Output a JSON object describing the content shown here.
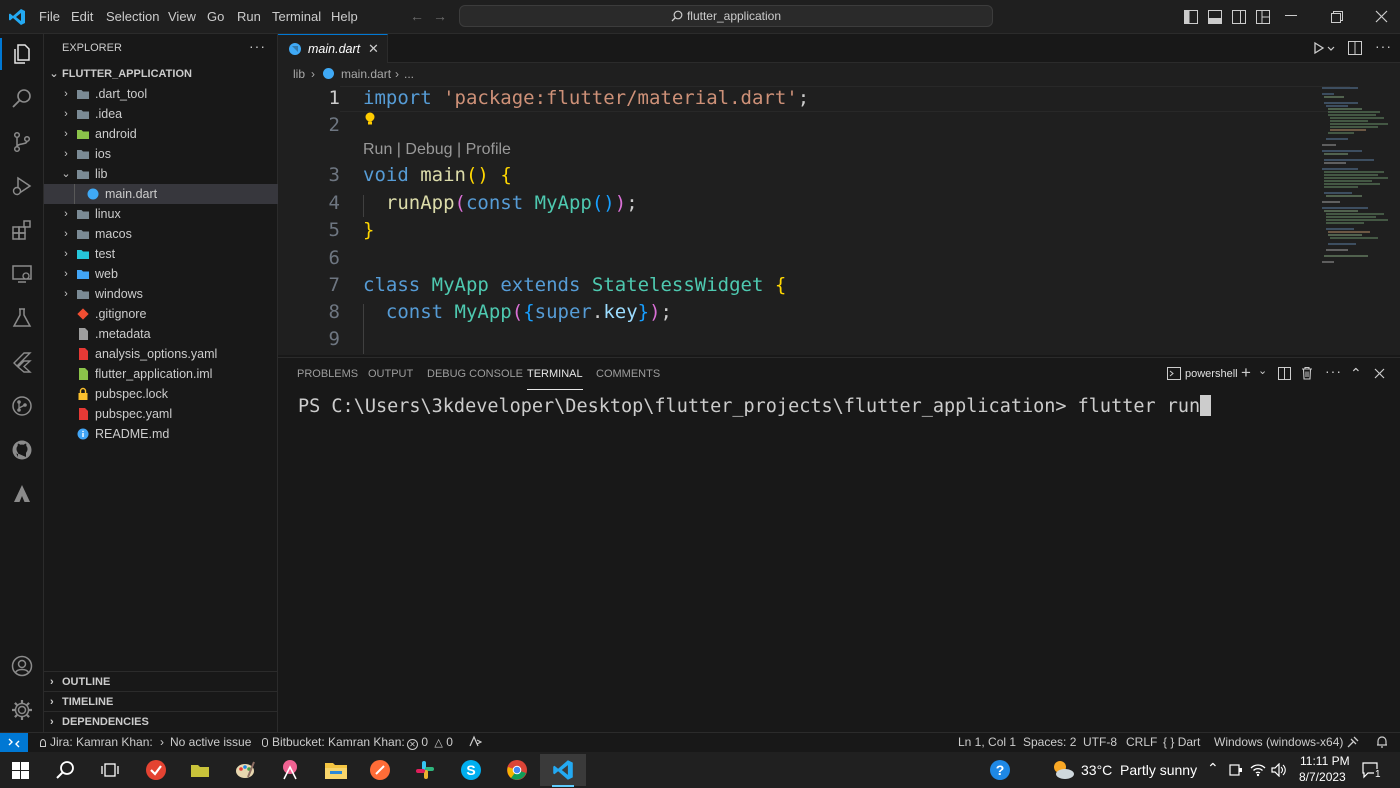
{
  "menu": [
    "File",
    "Edit",
    "Selection",
    "View",
    "Go",
    "Run",
    "Terminal",
    "Help"
  ],
  "command_center": "flutter_application",
  "explorer": {
    "header": "EXPLORER",
    "root": "FLUTTER_APPLICATION",
    "items": [
      {
        "label": ".dart_tool",
        "kind": "folder"
      },
      {
        "label": ".idea",
        "kind": "folder"
      },
      {
        "label": "android",
        "kind": "folder"
      },
      {
        "label": "ios",
        "kind": "folder"
      },
      {
        "label": "lib",
        "kind": "folder-open"
      },
      {
        "label": "main.dart",
        "kind": "dart-file"
      },
      {
        "label": "linux",
        "kind": "folder"
      },
      {
        "label": "macos",
        "kind": "folder"
      },
      {
        "label": "test",
        "kind": "folder"
      },
      {
        "label": "web",
        "kind": "folder"
      },
      {
        "label": "windows",
        "kind": "folder"
      },
      {
        "label": ".gitignore",
        "kind": "git-file"
      },
      {
        "label": ".metadata",
        "kind": "file"
      },
      {
        "label": "analysis_options.yaml",
        "kind": "yaml-file"
      },
      {
        "label": "flutter_application.iml",
        "kind": "iml-file"
      },
      {
        "label": "pubspec.lock",
        "kind": "lock-file"
      },
      {
        "label": "pubspec.yaml",
        "kind": "yaml-file"
      },
      {
        "label": "README.md",
        "kind": "info-file"
      }
    ],
    "sections": [
      "OUTLINE",
      "TIMELINE",
      "DEPENDENCIES"
    ]
  },
  "editor": {
    "tab_label": "main.dart",
    "breadcrumb": [
      "lib",
      "main.dart",
      "..."
    ],
    "codelens": "Run | Debug | Profile",
    "line_numbers": [
      "1",
      "2",
      "3",
      "4",
      "5",
      "6",
      "7",
      "8",
      "9"
    ]
  },
  "panel": {
    "tabs": [
      "PROBLEMS",
      "OUTPUT",
      "DEBUG CONSOLE",
      "TERMINAL",
      "COMMENTS"
    ],
    "active_tab": "TERMINAL",
    "shell": "powershell",
    "prompt": "PS C:\\Users\\3kdeveloper\\Desktop\\flutter_projects\\flutter_application> ",
    "command": "flutter run"
  },
  "statusbar": {
    "jira": "Jira: Kamran Khan:",
    "issue": "No active issue",
    "bitbucket": "Bitbucket: Kamran Khan:",
    "errors": "0",
    "warnings": "0",
    "position": "Ln 1, Col 1",
    "spaces": "Spaces: 2",
    "encoding": "UTF-8",
    "eol": "CRLF",
    "language": "Dart",
    "platform": "Windows (windows-x64)"
  },
  "taskbar": {
    "weather": "33°C  Partly sunny",
    "time": "11:11 PM",
    "date": "8/7/2023",
    "notifications": "1"
  },
  "colors": {
    "accent": "#0078d4",
    "keyword": "#569cd6",
    "string": "#ce9178",
    "type": "#4ec9b0",
    "function": "#dcdcaa"
  }
}
